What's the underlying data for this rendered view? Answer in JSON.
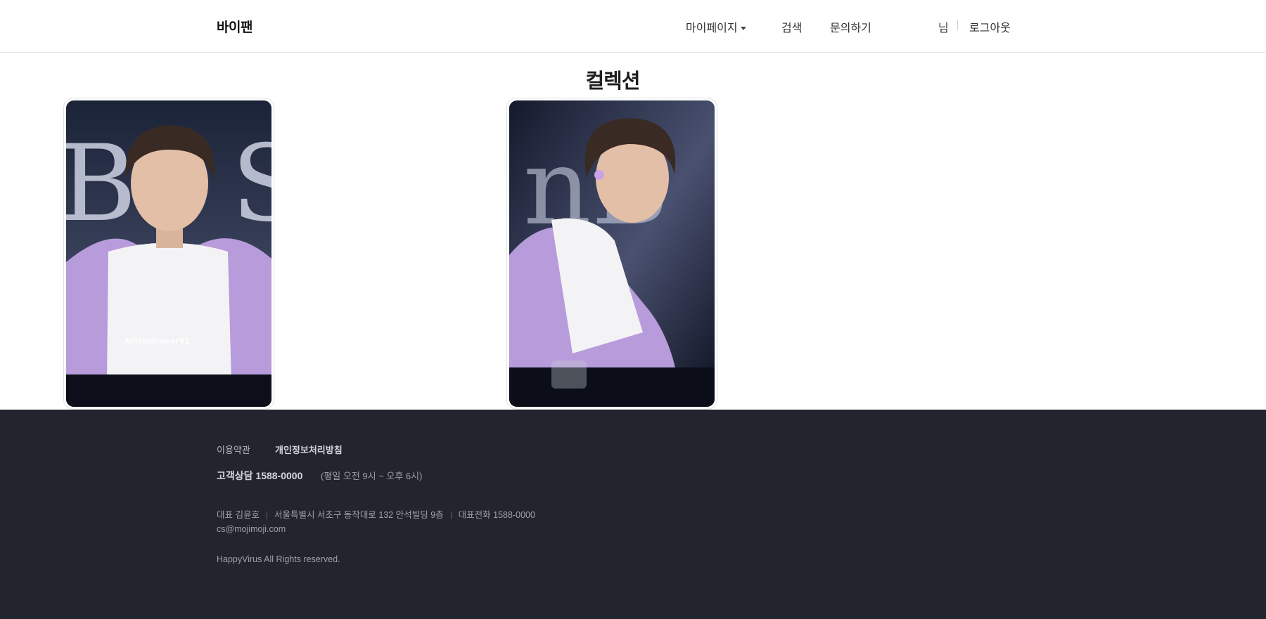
{
  "header": {
    "logo": "바이팬",
    "nav": {
      "mypage": "마이페이지",
      "search": "검색",
      "inquiry": "문의하기",
      "user_suffix": "님",
      "logout": "로그아웃"
    }
  },
  "main": {
    "title": "컬렉션",
    "cards": [
      {
        "photo_text": "Alittlebraver92"
      },
      {
        "photo_text": ""
      }
    ]
  },
  "footer": {
    "terms": "이용약관",
    "privacy": "개인정보처리방침",
    "cs_label": "고객상담 1588-0000",
    "cs_hours": "(평일 오전 9시 ~ 오후 6시)",
    "ceo": "대표 김윤호",
    "address": "서울특별시 서초구 동작대로 132 안석빌딩 9층",
    "phone": "대표전화 1588-0000",
    "email": "cs@mojimoji.com",
    "copyright": "HappyVirus All Rights reserved."
  },
  "colors": {
    "footer_bg": "#22252d",
    "hoodie": "#b79bdb",
    "stage_dark": "#0e1220"
  }
}
